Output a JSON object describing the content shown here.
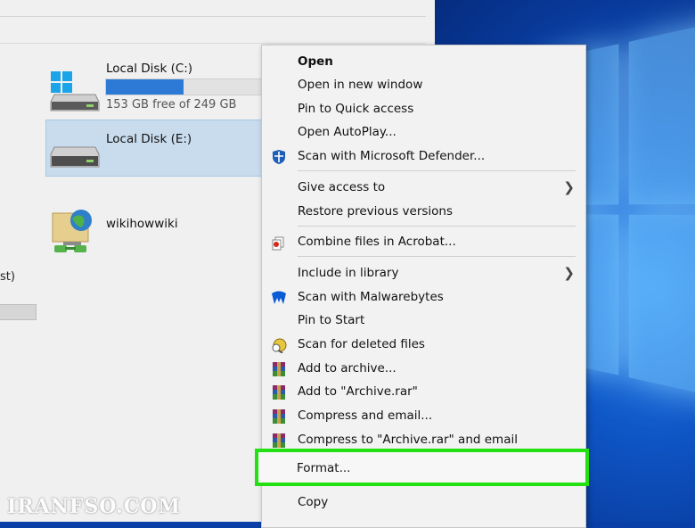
{
  "drives": {
    "c": {
      "label": "Local Disk (C:)",
      "free_text": "153 GB free of 249 GB",
      "used_fraction": 0.46
    },
    "e": {
      "label": "Local Disk (E:)"
    },
    "network": {
      "label": "wikihowwiki"
    },
    "partial_label": "st)"
  },
  "menu": {
    "items": [
      {
        "label": "Open"
      },
      {
        "label": "Open in new window"
      },
      {
        "label": "Pin to Quick access"
      },
      {
        "label": "Open AutoPlay..."
      },
      {
        "label": "Scan with Microsoft Defender..."
      },
      {
        "label": "Give access to"
      },
      {
        "label": "Restore previous versions"
      },
      {
        "label": "Combine files in Acrobat..."
      },
      {
        "label": "Include in library"
      },
      {
        "label": "Scan with Malwarebytes"
      },
      {
        "label": "Pin to Start"
      },
      {
        "label": "Scan for deleted files"
      },
      {
        "label": "Add to archive..."
      },
      {
        "label": "Add to \"Archive.rar\""
      },
      {
        "label": "Compress and email..."
      },
      {
        "label": "Compress to \"Archive.rar\" and email"
      },
      {
        "label": "Format..."
      },
      {
        "label": "Copy"
      }
    ],
    "highlight_color": "#22e012"
  },
  "watermark": "IRANFSO.COM",
  "colors": {
    "desktop_blue": "#0f57c8",
    "selection": "#c9dced",
    "accent": "#2c7ad6"
  }
}
